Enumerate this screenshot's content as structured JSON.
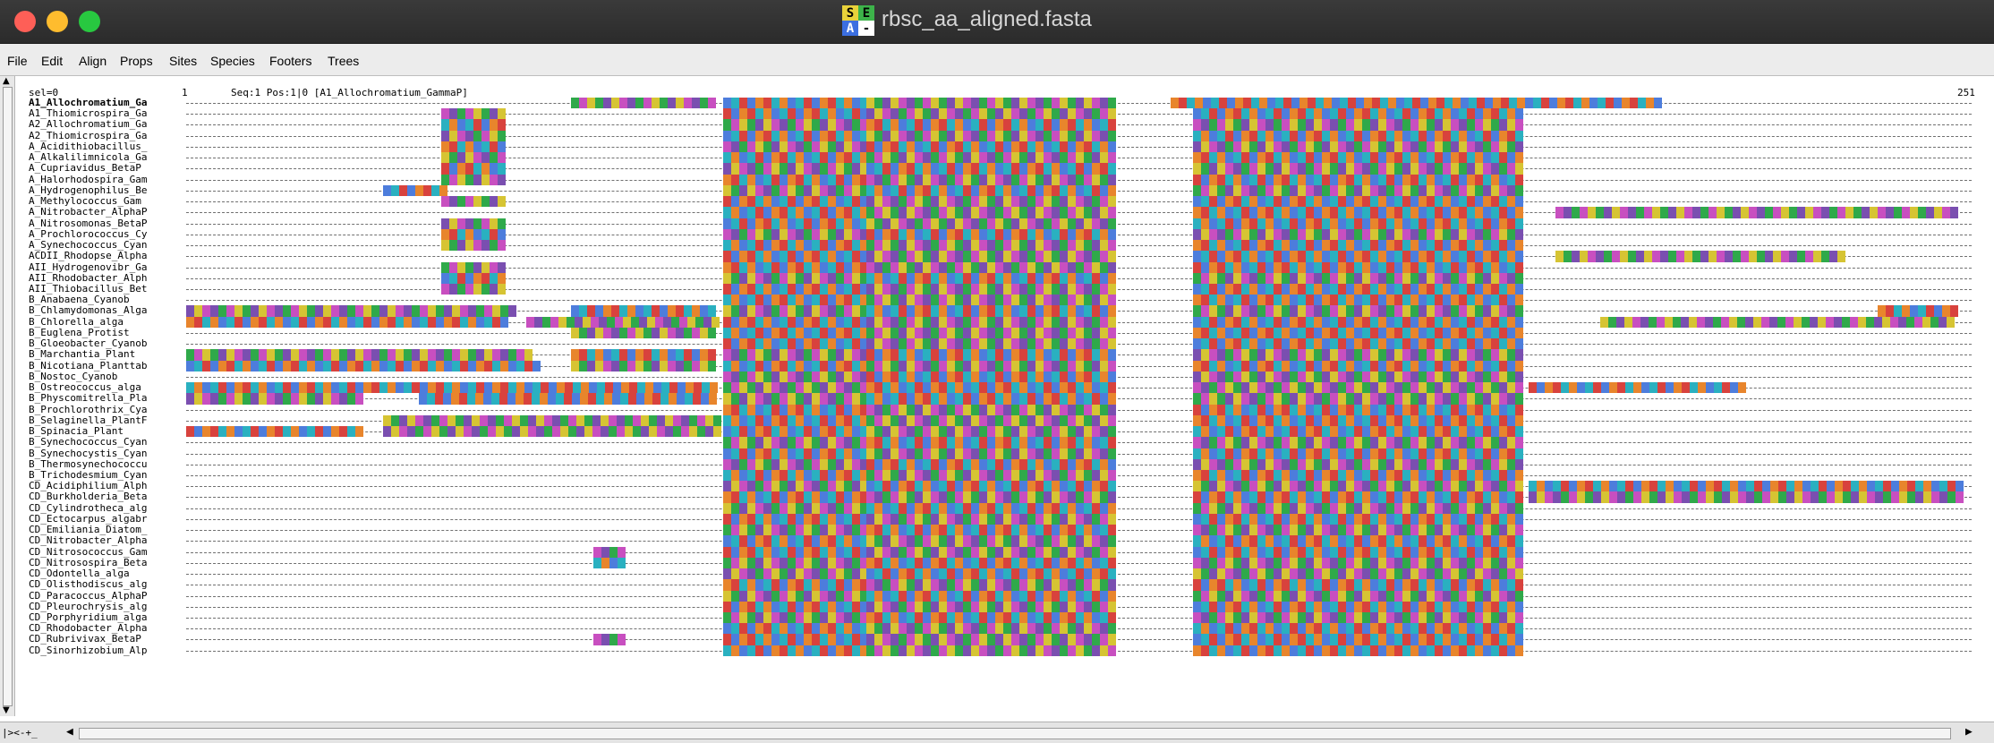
{
  "window": {
    "title": "rbsc_aa_aligned.fasta",
    "icon_letters": [
      "S",
      "E",
      "A",
      "-"
    ]
  },
  "menu": [
    "File",
    "Edit",
    "Align",
    "Props",
    "Sites",
    "Species",
    "Footers",
    "Trees"
  ],
  "status": {
    "selection": "sel=0",
    "position": "1",
    "seq_info": "Seq:1 Pos:1|0 [A1_Allochromatium_GammaP]",
    "end": "251"
  },
  "bottom_label": "|><-+_",
  "colors": {
    "blue": "#4d7ddc",
    "green": "#2fa94a",
    "red": "#d8423d",
    "yellow": "#d6c433",
    "orange": "#e8852c",
    "purple": "#7a4fb0",
    "cyan": "#2ab0c0",
    "magenta": "#c84fc0"
  },
  "sequences": [
    "A1_Allochromatium_Ga",
    "A1_Thiomicrospira_Ga",
    "A2_Allochromatium_Ga",
    "A2_Thiomicrospira_Ga",
    "A_Acidithiobacillus_",
    "A_Alkalilimnicola_Ga",
    "A_Cupriavidus_BetaP",
    "A_Halorhodospira_Gam",
    "A_Hydrogenophilus_Be",
    "A_Methylococcus_Gam",
    "A_Nitrobacter_AlphaP",
    "A_Nitrosomonas_BetaP",
    "A_Prochlorococcus_Cy",
    "A_Synechococcus_Cyan",
    "ACDII_Rhodopse_Alpha",
    "AII_Hydrogenovibr_Ga",
    "AII_Rhodobacter_Alph",
    "AII_Thiobacillus_Bet",
    "B_Anabaena_Cyanob",
    "B_Chlamydomonas_Alga",
    "B_Chlorella_alga",
    "B_Euglena_Protist",
    "B_Gloeobacter_Cyanob",
    "B_Marchantia_Plant",
    "B_Nicotiana_Planttab",
    "B_Nostoc_Cyanob",
    "B_Ostreococcus_alga",
    "B_Physcomitrella_Pla",
    "B_Prochlorothrix_Cya",
    "B_Selaginella_PlantF",
    "B_Spinacia_Plant",
    "B_Synechococcus_Cyan",
    "B_Synechocystis_Cyan",
    "B_Thermosynechococcu",
    "B_Trichodesmium_Cyan",
    "CD_Acidiphilium_Alph",
    "CD_Burkholderia_Beta",
    "CD_Cylindrotheca_alg",
    "CD_Ectocarpus_algabr",
    "CD_Emiliania_Diatom_",
    "CD_Nitrobacter_Alpha",
    "CD_Nitrosococcus_Gam",
    "CD_Nitrosospira_Beta",
    "CD_Odontella_alga",
    "CD_Olisthodiscus_alg",
    "CD_Paracoccus_AlphaP",
    "CD_Pleurochrysis_alg",
    "CD_Porphyridium_alga",
    "CD_Rhodobacter_Alpha",
    "CD_Rubrivivax_BetaP",
    "CD_Sinorhizobium_Alp"
  ]
}
